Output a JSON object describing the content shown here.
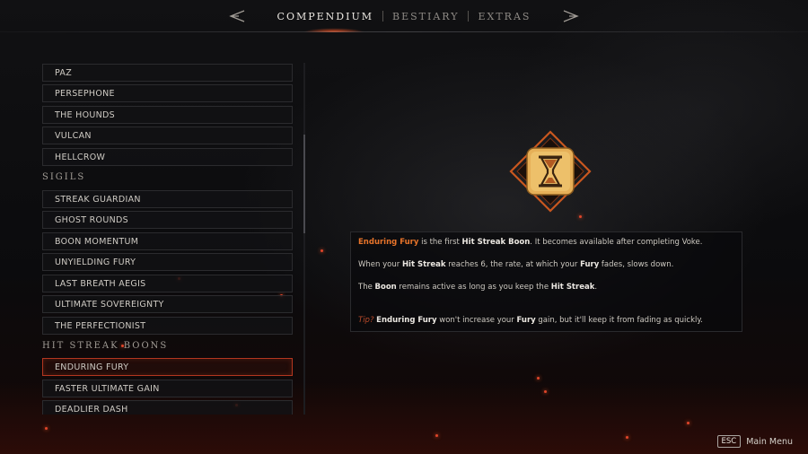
{
  "nav": {
    "tabs": [
      "COMPENDIUM",
      "BESTIARY",
      "EXTRAS"
    ],
    "active_tab": "COMPENDIUM"
  },
  "list": {
    "groups_top": [
      "PAZ",
      "PERSEPHONE",
      "THE HOUNDS",
      "VULCAN",
      "HELLCROW"
    ],
    "sigils_heading": "SIGILS",
    "sigils": [
      "STREAK GUARDIAN",
      "GHOST ROUNDS",
      "BOON MOMENTUM",
      "UNYIELDING FURY",
      "LAST BREATH AEGIS",
      "ULTIMATE SOVEREIGNTY",
      "THE PERFECTIONIST"
    ],
    "boons_heading": "HIT STREAK BOONS",
    "boons": [
      "ENDURING FURY",
      "FASTER ULTIMATE GAIN",
      "DEADLIER DASH"
    ],
    "selected": "ENDURING FURY"
  },
  "emblem": {
    "icon": "hourglass-icon"
  },
  "description": {
    "l1_a": "Enduring Fury",
    "l1_b": " is the first ",
    "l1_c": "Hit Streak Boon",
    "l1_d": ". It becomes available after completing Voke.",
    "l2_a": "When your ",
    "l2_b": "Hit Streak",
    "l2_c": " reaches 6, the rate, at which your ",
    "l2_d": "Fury",
    "l2_e": " fades, slows down.",
    "l3_a": "The ",
    "l3_b": "Boon",
    "l3_c": " remains active as long as you keep the ",
    "l3_d": "Hit Streak",
    "l3_e": ".",
    "tip_a": "Tip?",
    "tip_b": "Enduring Fury",
    "tip_c": " won't increase your ",
    "tip_d": "Fury",
    "tip_e": " gain, but it'll keep it from fading as quickly."
  },
  "footer": {
    "key": "ESC",
    "label": "Main Menu"
  },
  "colors": {
    "accent": "#e8742a",
    "selected_border": "#b3361f",
    "emblem_gold": "#e9b45a"
  }
}
